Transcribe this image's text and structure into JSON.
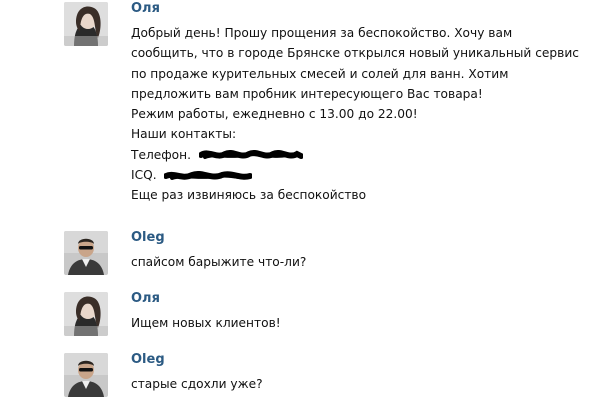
{
  "messages": [
    {
      "author": "Оля",
      "lines": [
        "Добрый день! Прошу прощения за беспокойство. Хочу вам",
        "сообщить, что в городе Брянске открылся новый уникальный сервис",
        "по продаже курительных смесей и солей для ванн. Хотим",
        "предложить вам пробник интересующего Вас товара!",
        "Режим работы, ежедневно с 13.00 до 22.00!",
        "Наши контакты:"
      ],
      "phone_label": "Телефон.",
      "icq_label": "ICQ.",
      "closing": "Еще раз извиняюсь за беспокойство"
    },
    {
      "author": "Oleg",
      "lines": [
        "спайсом барыжите что-ли?"
      ]
    },
    {
      "author": "Оля",
      "lines": [
        "Ищем новых клиентов!"
      ]
    },
    {
      "author": "Oleg",
      "lines": [
        "старые сдохли уже?"
      ]
    }
  ],
  "colors": {
    "author_link": "#2b5a83",
    "text": "#111111",
    "background": "#ffffff"
  }
}
